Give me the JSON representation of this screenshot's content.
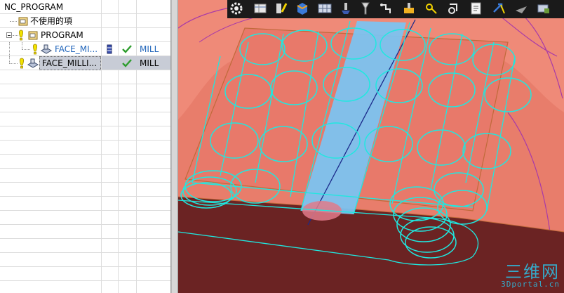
{
  "navigator": {
    "rows": [
      {
        "name": "NC_PROGRAM"
      },
      {
        "name": "不使用的項"
      },
      {
        "name": "PROGRAM"
      },
      {
        "name": "FACE_MI...",
        "status": "MILL"
      },
      {
        "name": "FACE_MILLI...",
        "status": "MILL",
        "selected": true
      }
    ]
  },
  "toolbar": {
    "buttons": [
      "gear-icon",
      "table-icon",
      "marker-icon",
      "cube-icon",
      "grid-icon",
      "tool-icon",
      "pin-icon",
      "path-icon",
      "probe-icon",
      "key-icon",
      "refresh-icon",
      "document-icon",
      "arrow-icon",
      "arrow-icon",
      "rectangle-icon"
    ]
  },
  "watermark": {
    "main": "三维网",
    "sub": "3Dportal.cn"
  },
  "colors": {
    "surface": "#e87d6b",
    "base": "#6b2323",
    "toolpath": "#1fe8e0",
    "cut_region": "#7cc3f0",
    "edge_purple": "#a83aa8",
    "selected_row": "#c8ccd6",
    "check_green": "#2e9d2e",
    "link_blue": "#2266bb"
  }
}
